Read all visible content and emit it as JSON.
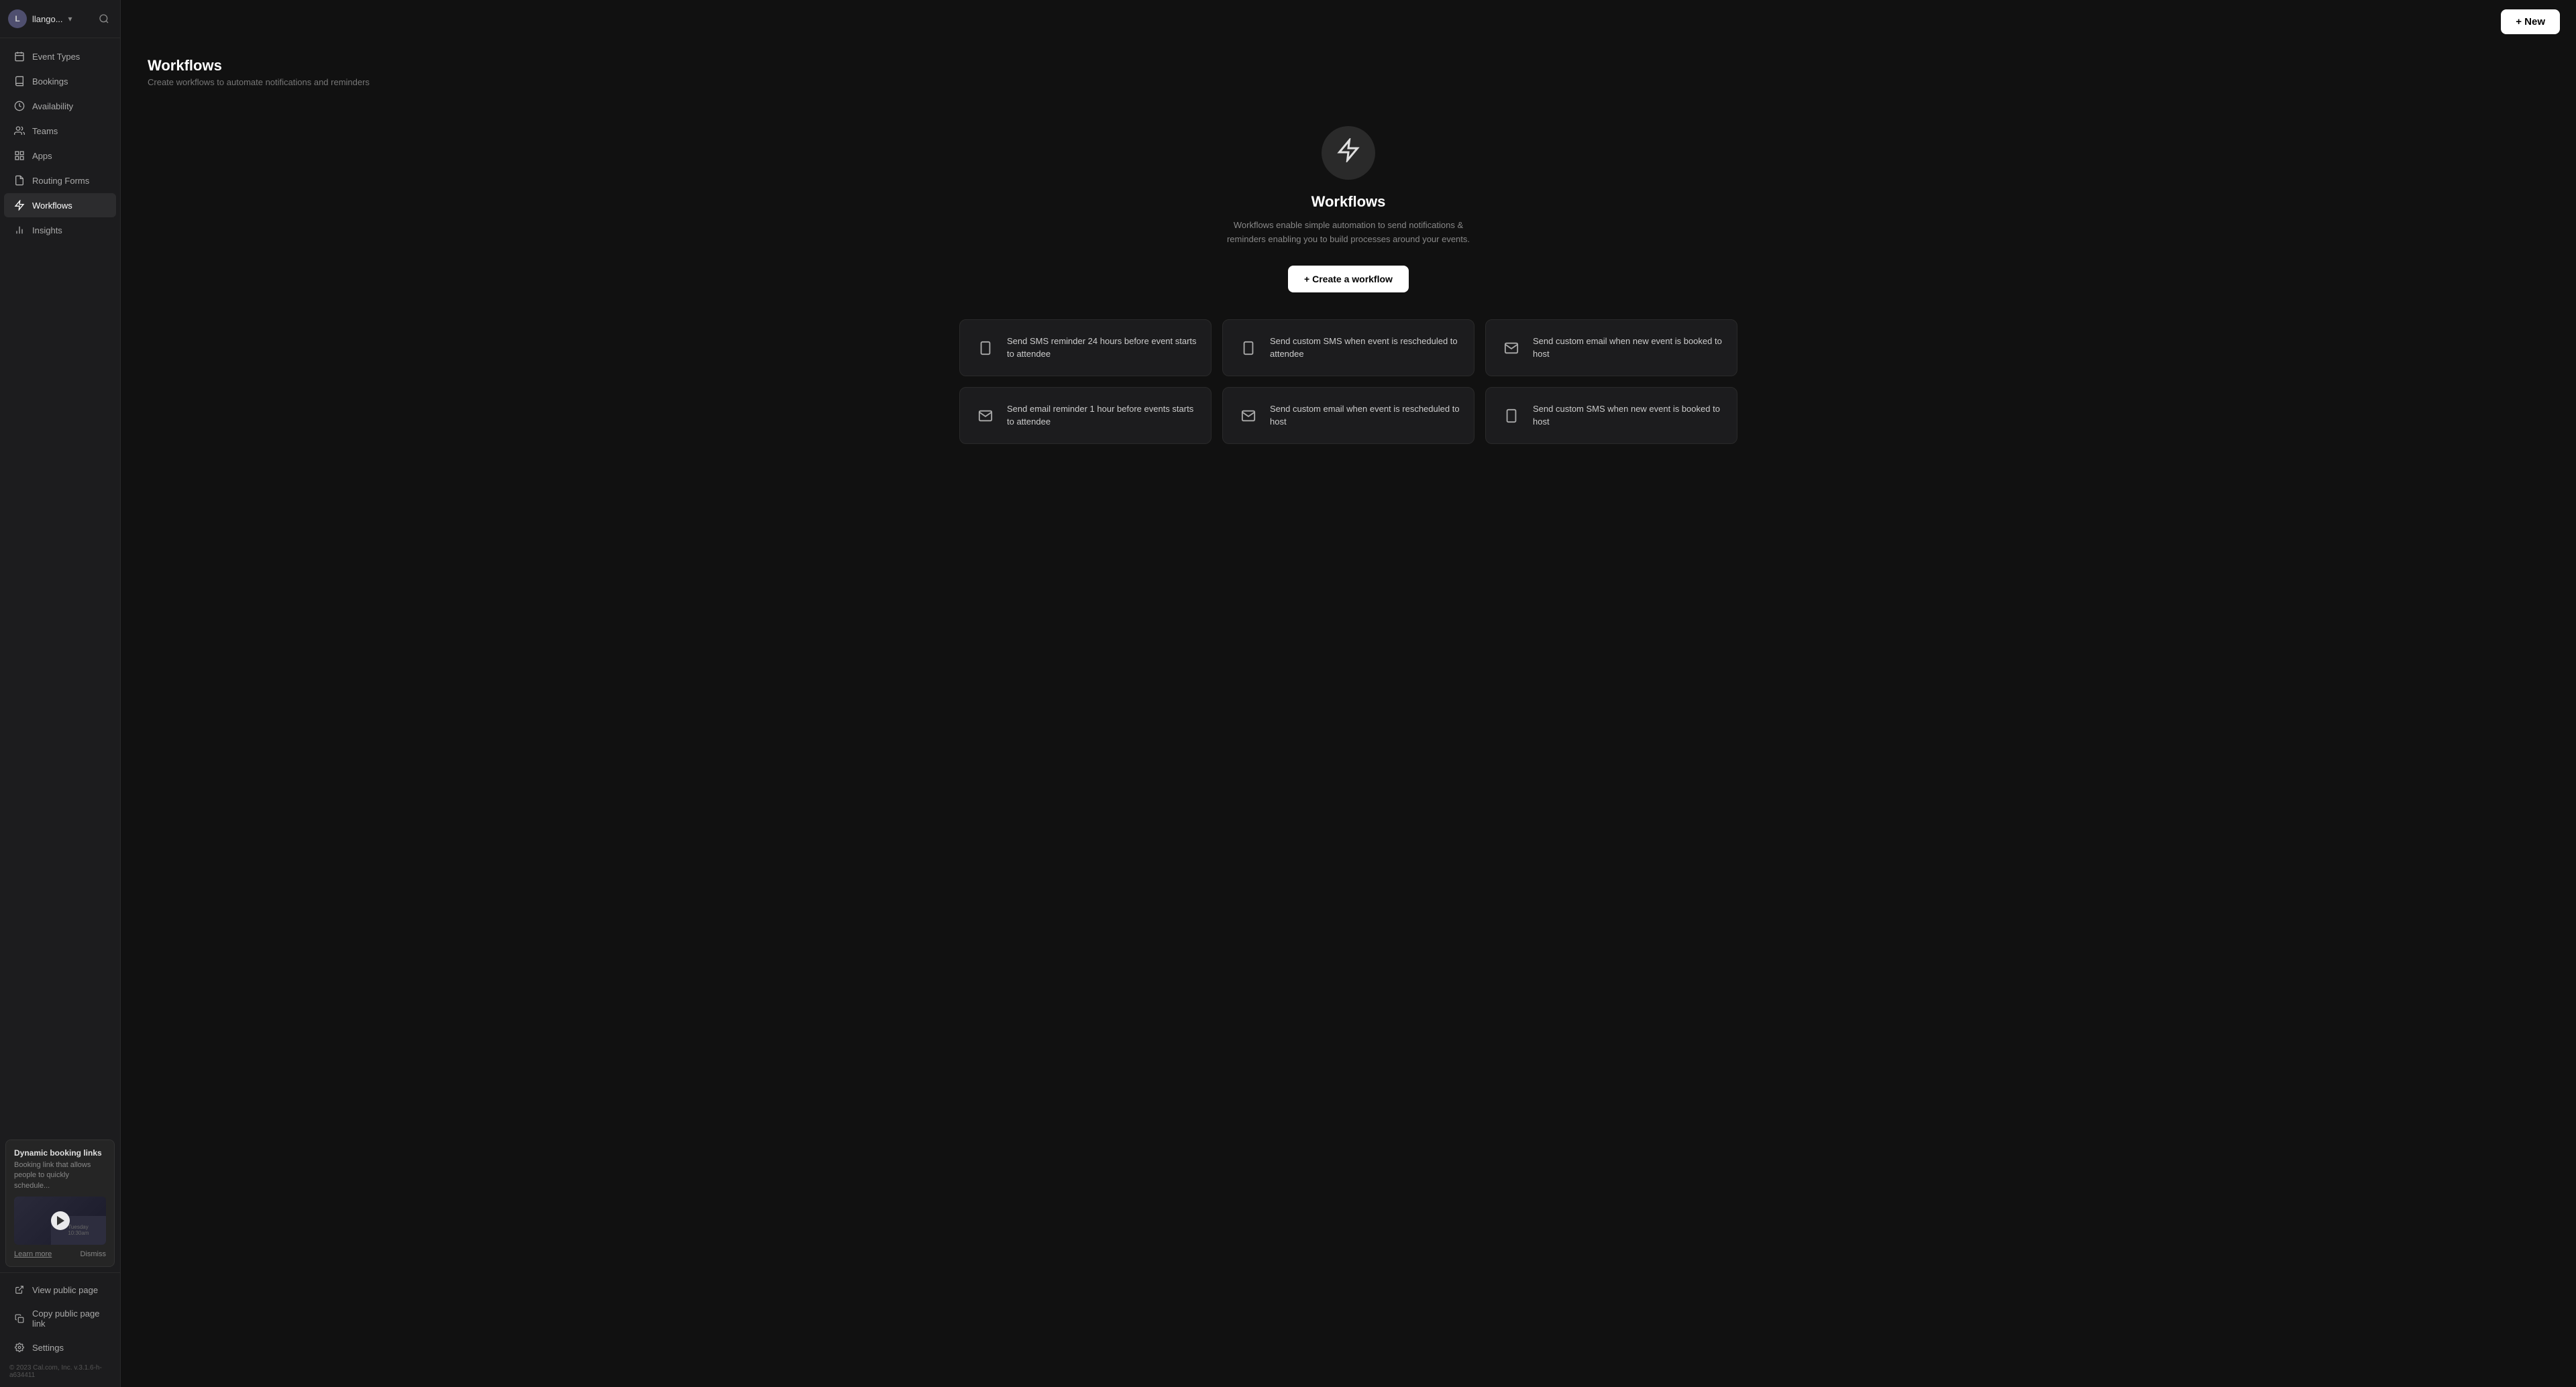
{
  "sidebar": {
    "user": {
      "name": "llango...",
      "avatar_initial": "L"
    },
    "nav_items": [
      {
        "id": "event-types",
        "label": "Event Types",
        "icon": "calendar"
      },
      {
        "id": "bookings",
        "label": "Bookings",
        "icon": "book"
      },
      {
        "id": "availability",
        "label": "Availability",
        "icon": "clock"
      },
      {
        "id": "teams",
        "label": "Teams",
        "icon": "users"
      },
      {
        "id": "apps",
        "label": "Apps",
        "icon": "grid"
      },
      {
        "id": "routing-forms",
        "label": "Routing Forms",
        "icon": "file"
      },
      {
        "id": "workflows",
        "label": "Workflows",
        "icon": "zap",
        "active": true
      },
      {
        "id": "insights",
        "label": "Insights",
        "icon": "bar-chart"
      }
    ],
    "dynamic_booking": {
      "title": "Dynamic booking links",
      "description": "Booking link that allows people to quickly schedule...",
      "learn_more": "Learn more",
      "dismiss": "Dismiss"
    },
    "bottom_links": [
      {
        "id": "view-public-page",
        "label": "View public page",
        "icon": "external-link"
      },
      {
        "id": "copy-public-page-link",
        "label": "Copy public page link",
        "icon": "copy"
      },
      {
        "id": "settings",
        "label": "Settings",
        "icon": "settings"
      }
    ],
    "footer_text": "© 2023 Cal.com, Inc. v.3.1.6-h-a634411"
  },
  "topbar": {
    "new_button_label": "+ New"
  },
  "page": {
    "title": "Workflows",
    "subtitle": "Create workflows to automate notifications and reminders",
    "hero_title": "Workflows",
    "hero_desc": "Workflows enable simple automation to send notifications & reminders enabling you to build processes around your events.",
    "create_button_label": "+ Create a workflow"
  },
  "workflow_templates": [
    {
      "id": "sms-reminder-24h",
      "icon": "mobile",
      "text": "Send SMS reminder 24 hours before event starts to attendee"
    },
    {
      "id": "custom-sms-rescheduled-attendee",
      "icon": "mobile",
      "text": "Send custom SMS when event is rescheduled to attendee"
    },
    {
      "id": "custom-email-booked-host",
      "icon": "mail",
      "text": "Send custom email when new event is booked to host"
    },
    {
      "id": "email-reminder-1h",
      "icon": "mail",
      "text": "Send email reminder 1 hour before events starts to attendee"
    },
    {
      "id": "custom-email-rescheduled-host",
      "icon": "mail",
      "text": "Send custom email when event is rescheduled to host"
    },
    {
      "id": "custom-sms-booked-host",
      "icon": "mobile",
      "text": "Send custom SMS when new event is booked to host"
    }
  ]
}
